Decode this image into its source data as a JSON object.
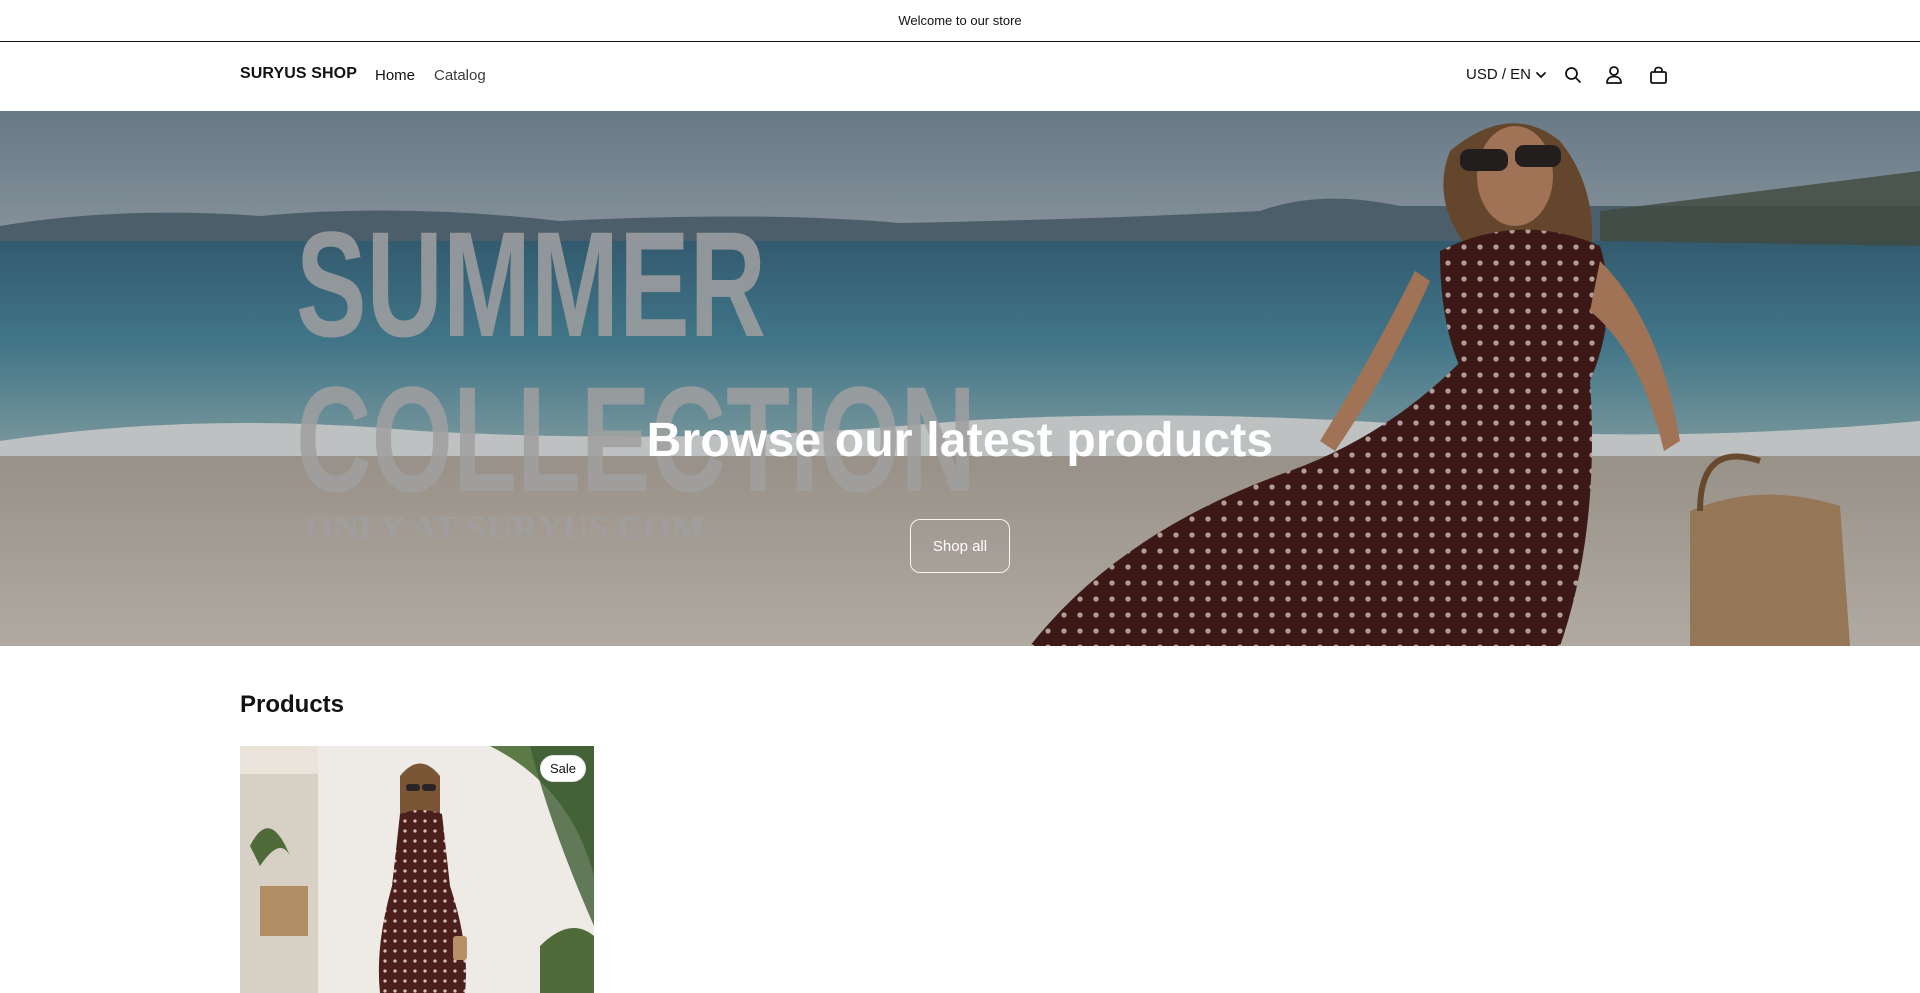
{
  "announcement": {
    "text": "Welcome to our store"
  },
  "header": {
    "brand": "SURYUS SHOP",
    "nav": [
      {
        "label": "Home"
      },
      {
        "label": "Catalog"
      }
    ],
    "locale": "USD / EN",
    "icons": [
      "search-icon",
      "account-icon",
      "cart-icon"
    ]
  },
  "hero": {
    "image_text": {
      "line1": "SUMMER",
      "line2": "COLLECTION",
      "line3": "ONLY AT SURYUS.COM"
    },
    "heading": "Browse our latest products",
    "button": "Shop all"
  },
  "products": {
    "title": "Products",
    "items": [
      {
        "badge": "Sale"
      }
    ]
  },
  "colors": {
    "text": "#121212",
    "dress": "#4a1f1c",
    "sea": "#3d7f98"
  }
}
